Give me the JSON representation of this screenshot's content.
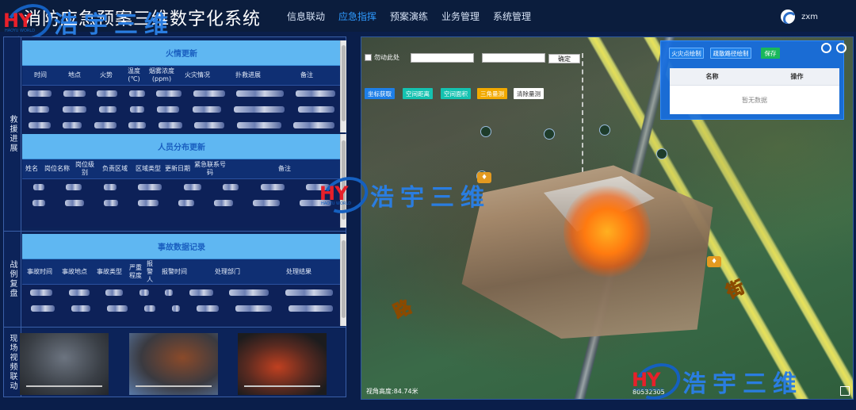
{
  "header": {
    "title": "消防应急预案三维数字化系统",
    "nav": [
      {
        "label": "信息联动",
        "active": false
      },
      {
        "label": "应急指挥",
        "active": true
      },
      {
        "label": "预案演练",
        "active": false
      },
      {
        "label": "业务管理",
        "active": false
      },
      {
        "label": "系统管理",
        "active": false
      }
    ],
    "user": {
      "name": "zxm",
      "icon": "user-avatar-icon"
    }
  },
  "watermark": {
    "mark": "HY",
    "sub": "HAOYU WORLD",
    "text": "浩宇三维"
  },
  "left_panel": {
    "sections": {
      "rescue": "救援进展",
      "review": "战例复盘",
      "video": "现场视频联动"
    },
    "fire_table": {
      "title": "火情更新",
      "columns": [
        "时间",
        "地点",
        "火势",
        "温度(℃)",
        "烟雾浓度(ppm)",
        "火灾情况",
        "扑救进展",
        "备注"
      ]
    },
    "staff_table": {
      "title": "人员分布更新",
      "columns": [
        "姓名",
        "岗位名称",
        "岗位级别",
        "负责区域",
        "区域类型",
        "更新日期",
        "紧急联系号码",
        "备注"
      ]
    },
    "accident_table": {
      "title": "事故数据记录",
      "columns": [
        "事故时间",
        "事故地点",
        "事故类型",
        "严重程度",
        "报警人",
        "报警时间",
        "处理部门",
        "处理结果"
      ]
    }
  },
  "map": {
    "toolbar": {
      "checkbox_label": "勿动此处",
      "confirm": "确定",
      "buttons": [
        {
          "label": "坐标获取",
          "color": "#1e7fe8"
        },
        {
          "label": "空间距离",
          "color": "#14c2b0"
        },
        {
          "label": "空间面积",
          "color": "#14c2b0"
        },
        {
          "label": "三角量测",
          "color": "#f2a900"
        },
        {
          "label": "清除量测",
          "color": "#ffffff"
        }
      ]
    },
    "fire_panel": {
      "buttons": [
        {
          "label": "火灾点绘制",
          "color": "#1e7fe8"
        },
        {
          "label": "疏散路径绘制",
          "color": "#1e7fe8"
        },
        {
          "label": "保存",
          "color": "#19b85a"
        }
      ],
      "columns": [
        "名称",
        "操作"
      ],
      "empty_text": "暂无数据"
    },
    "road_labels": [
      "路",
      "街"
    ],
    "status": {
      "height_label": "视角高度:",
      "height_value": "84.74米",
      "coord": "80532305"
    }
  }
}
